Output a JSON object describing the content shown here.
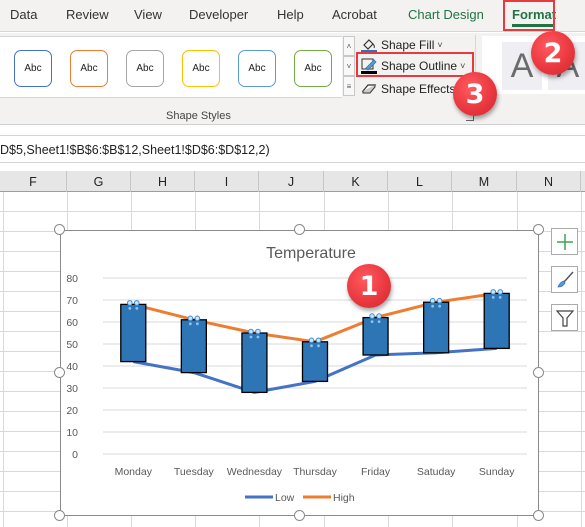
{
  "ribbon": {
    "tabs": [
      {
        "label": "Data",
        "state": "normal"
      },
      {
        "label": "Review",
        "state": "normal"
      },
      {
        "label": "View",
        "state": "normal"
      },
      {
        "label": "Developer",
        "state": "normal"
      },
      {
        "label": "Help",
        "state": "normal"
      },
      {
        "label": "Acrobat",
        "state": "normal"
      },
      {
        "label": "Chart Design",
        "state": "contextual"
      },
      {
        "label": "Format",
        "state": "active"
      }
    ],
    "shape_styles": {
      "swatches": [
        {
          "label": "Abc",
          "color": "#4472c4"
        },
        {
          "label": "Abc",
          "color": "#ed7d31"
        },
        {
          "label": "Abc",
          "color": "#a5a5a5"
        },
        {
          "label": "Abc",
          "color": "#ffc000"
        },
        {
          "label": "Abc",
          "color": "#5b9bd5"
        },
        {
          "label": "Abc",
          "color": "#70ad47"
        }
      ],
      "group_label": "Shape Styles",
      "commands": {
        "fill": "Shape Fill",
        "outline": "Shape Outline",
        "effects": "Shape Effects"
      }
    },
    "wordart": {
      "glyph": "A"
    }
  },
  "formula_bar": {
    "text": "D$5,Sheet1!$B$6:$B$12,Sheet1!$D$6:$D$12,2)"
  },
  "sheet": {
    "columns": [
      "F",
      "G",
      "H",
      "I",
      "J",
      "K",
      "L",
      "M",
      "N"
    ]
  },
  "callouts": {
    "one": "1",
    "two": "2",
    "three": "3"
  },
  "colors": {
    "accent_green": "#217346",
    "callout_red": "#e63a3f",
    "bar_blue": "#2e75b6",
    "low_line": "#4472c4",
    "high_line": "#ed7d31"
  },
  "chart_data": {
    "type": "bar",
    "title": "Temperature",
    "xlabel": "",
    "ylabel": "",
    "categories": [
      "Monday",
      "Tuesday",
      "Wednesday",
      "Thursday",
      "Friday",
      "Satuday",
      "Sunday"
    ],
    "ylim": [
      0,
      80
    ],
    "yticks": [
      0,
      10,
      20,
      30,
      40,
      50,
      60,
      70,
      80
    ],
    "grid": true,
    "legend_position": "bottom",
    "series": [
      {
        "name": "Low",
        "kind": "line",
        "values": [
          42,
          37,
          28,
          33,
          45,
          46,
          48
        ]
      },
      {
        "name": "High",
        "kind": "line",
        "values": [
          68,
          61,
          55,
          51,
          62,
          69,
          73
        ]
      }
    ],
    "floating_bars": {
      "description": "up bars spanning Low to High",
      "from": "Low",
      "to": "High"
    },
    "legend": [
      "Low",
      "High"
    ]
  }
}
